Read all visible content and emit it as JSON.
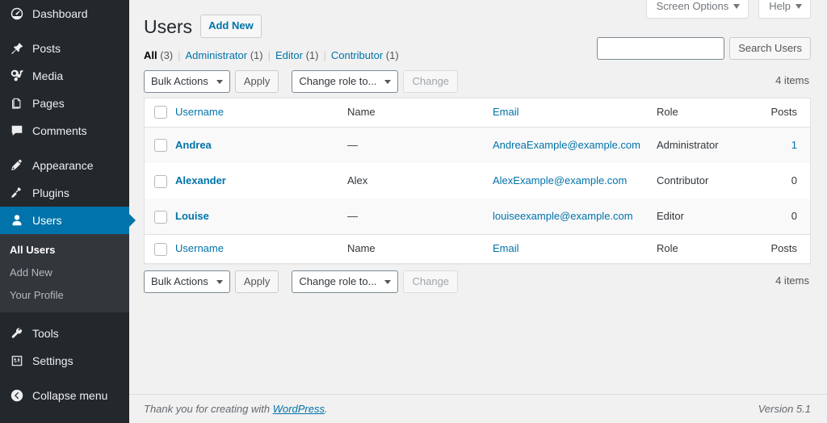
{
  "sidebar": {
    "items": [
      {
        "label": "Dashboard",
        "icon": "dashboard-icon",
        "name": "sidebar-item-dashboard",
        "gap": false
      },
      {
        "label": "Posts",
        "icon": "pin-icon",
        "name": "sidebar-item-posts",
        "gap": true
      },
      {
        "label": "Media",
        "icon": "media-icon",
        "name": "sidebar-item-media",
        "gap": false
      },
      {
        "label": "Pages",
        "icon": "pages-icon",
        "name": "sidebar-item-pages",
        "gap": false
      },
      {
        "label": "Comments",
        "icon": "comments-icon",
        "name": "sidebar-item-comments",
        "gap": false
      },
      {
        "label": "Appearance",
        "icon": "appearance-icon",
        "name": "sidebar-item-appearance",
        "gap": true
      },
      {
        "label": "Plugins",
        "icon": "plugins-icon",
        "name": "sidebar-item-plugins",
        "gap": false
      },
      {
        "label": "Users",
        "icon": "users-icon",
        "name": "sidebar-item-users",
        "gap": false,
        "current": true
      },
      {
        "label": "Tools",
        "icon": "tools-icon",
        "name": "sidebar-item-tools",
        "gap": true
      },
      {
        "label": "Settings",
        "icon": "settings-icon",
        "name": "sidebar-item-settings",
        "gap": false
      },
      {
        "label": "Collapse menu",
        "icon": "collapse-icon",
        "name": "sidebar-item-collapse",
        "gap": true
      }
    ],
    "submenu": [
      {
        "label": "All Users",
        "current": true
      },
      {
        "label": "Add New",
        "current": false
      },
      {
        "label": "Your Profile",
        "current": false
      }
    ],
    "accent_color": "#0073aa",
    "background_color": "#23282d",
    "submenu_background_color": "#32373c"
  },
  "screen_meta": {
    "screen_options_label": "Screen Options",
    "help_label": "Help"
  },
  "header": {
    "title": "Users",
    "add_new_label": "Add New"
  },
  "search": {
    "value": "",
    "placeholder": "",
    "button_label": "Search Users"
  },
  "filters": [
    {
      "label": "All",
      "count": "(3)",
      "current": true
    },
    {
      "label": "Administrator",
      "count": "(1)",
      "current": false
    },
    {
      "label": "Editor",
      "count": "(1)",
      "current": false
    },
    {
      "label": "Contributor",
      "count": "(1)",
      "current": false
    }
  ],
  "tablenav_top": {
    "bulk_actions_label": "Bulk Actions",
    "apply_label": "Apply",
    "change_role_label": "Change role to...",
    "change_label": "Change",
    "displaying_num": "4 items"
  },
  "tablenav_bottom": {
    "bulk_actions_label": "Bulk Actions",
    "apply_label": "Apply",
    "change_role_label": "Change role to...",
    "change_label": "Change",
    "displaying_num": "4 items"
  },
  "table": {
    "columns": [
      {
        "label": "Username",
        "link": true
      },
      {
        "label": "Name",
        "link": false
      },
      {
        "label": "Email",
        "link": true
      },
      {
        "label": "Role",
        "link": false
      },
      {
        "label": "Posts",
        "link": false
      }
    ],
    "rows": [
      {
        "username": "Andrea",
        "name": "—",
        "email": "AndreaExample@example.com",
        "role": "Administrator",
        "posts": "1",
        "posts_is_link": true
      },
      {
        "username": "Alexander",
        "name": "Alex",
        "email": "AlexExample@example.com",
        "role": "Contributor",
        "posts": "0",
        "posts_is_link": false
      },
      {
        "username": "Louise",
        "name": "—",
        "email": "louiseexample@example.com",
        "role": "Editor",
        "posts": "0",
        "posts_is_link": false
      }
    ]
  },
  "footer": {
    "thanks_prefix": "Thank you for creating with ",
    "wordpress_label": "WordPress",
    "thanks_suffix": ".",
    "version": "Version 5.1"
  }
}
